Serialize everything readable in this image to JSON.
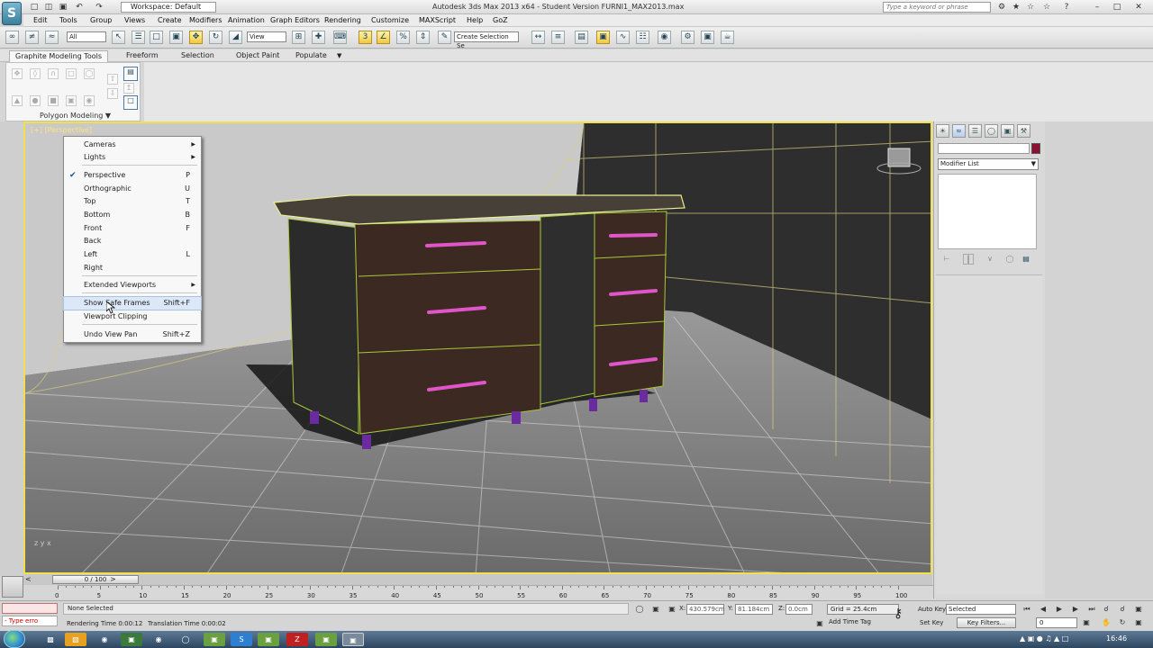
{
  "titlebar": {
    "workspace": "Workspace: Default",
    "title": "Autodesk 3ds Max  2013 x64  - Student Version    FURNI1_MAX2013.max",
    "search_placeholder": "Type a keyword or phrase"
  },
  "menu": [
    "Edit",
    "Tools",
    "Group",
    "Views",
    "Create",
    "Modifiers",
    "Animation",
    "Graph Editors",
    "Rendering",
    "Customize",
    "MAXScript",
    "Help",
    "GoZ"
  ],
  "toolbar": {
    "selection_filter": "All",
    "ref_coord": "View",
    "named_selection": "Create Selection Se"
  },
  "ribbon": {
    "tabs": [
      "Graphite Modeling Tools",
      "Freeform",
      "Selection",
      "Object Paint",
      "Populate"
    ],
    "panel_label": "Polygon Modeling"
  },
  "viewport": {
    "label": "[+] [Perspective]",
    "axis": "z y x",
    "context_menu": {
      "items": [
        {
          "label": "Cameras",
          "submenu": true
        },
        {
          "label": "Lights",
          "submenu": true
        },
        {
          "label": "Perspective",
          "shortcut": "P",
          "checked": true
        },
        {
          "label": "Orthographic",
          "shortcut": "U"
        },
        {
          "label": "Top",
          "shortcut": "T"
        },
        {
          "label": "Bottom",
          "shortcut": "B"
        },
        {
          "label": "Front",
          "shortcut": "F"
        },
        {
          "label": "Back",
          "shortcut": ""
        },
        {
          "label": "Left",
          "shortcut": "L"
        },
        {
          "label": "Right",
          "shortcut": ""
        },
        {
          "label": "Extended Viewports",
          "submenu": true
        },
        {
          "label": "Show Safe Frames",
          "shortcut": "Shift+F",
          "highlighted": true
        },
        {
          "label": "Viewport Clipping",
          "shortcut": ""
        },
        {
          "label": "Undo View Pan",
          "shortcut": "Shift+Z"
        }
      ]
    }
  },
  "command_panel": {
    "modifier_list": "Modifier List",
    "swatch_color": "#8a1230"
  },
  "timeline": {
    "slider": "0 / 100",
    "ticks": [
      "0",
      "5",
      "10",
      "15",
      "20",
      "25",
      "30",
      "35",
      "40",
      "45",
      "50",
      "55",
      "60",
      "65",
      "70",
      "75",
      "80",
      "85",
      "90",
      "95",
      "100"
    ]
  },
  "status": {
    "maxscript_error": "- Type erro",
    "prompt": "None Selected",
    "render_time": "Rendering Time  0:00:12",
    "translation_time": "Translation Time  0:00:02",
    "x_label": "X:",
    "x_value": "430.579cm",
    "y_label": "Y:",
    "y_value": "81.184cm",
    "z_label": "Z:",
    "z_value": "0.0cm",
    "grid": "Grid = 25.4cm",
    "add_time_tag": "Add Time Tag",
    "auto_key": "Auto Key",
    "auto_key_value": "Selected",
    "set_key": "Set Key",
    "key_filters": "Key Filters...",
    "frame": "0"
  },
  "taskbar": {
    "clock": "16:46"
  }
}
